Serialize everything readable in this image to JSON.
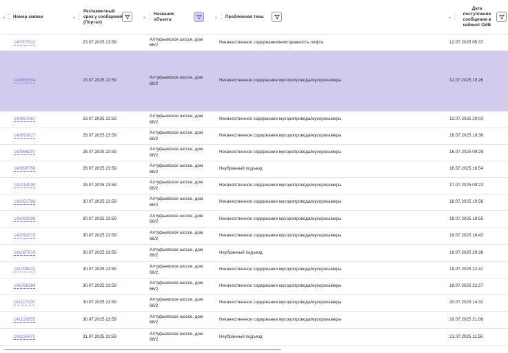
{
  "columns": [
    {
      "key": "number",
      "label": "Номер заявки"
    },
    {
      "key": "deadline",
      "label": "Регламентный срок у сообщения (Портал)"
    },
    {
      "key": "object",
      "label": "Название объекта"
    },
    {
      "key": "topic",
      "label": "Проблемная тема"
    },
    {
      "key": "received",
      "label": "Дата поступления сообщения в кабинет ОИВ"
    }
  ],
  "rows": [
    {
      "number": "140707912",
      "deadline": "23.07.2025 23:59",
      "object": "Алтуфьевское шоссе, дом 66/2",
      "topic": "Некачественное содержание/неисправность лифта",
      "received": "12.07.2025 05:37"
    },
    {
      "number": "140863564",
      "deadline": "23.07.2025 23:59",
      "object": "Алтуфьевское шоссе, дом 66/2",
      "topic": "Некачественное содержание мусоропровода/мусорокамеры",
      "received": "12.07.2025 19:26",
      "selected": true
    },
    {
      "number": "140867867",
      "deadline": "23.07.2025 23:59",
      "object": "Алтуфьевское шоссе, дом 66/2",
      "topic": "Некачественное содержание мусоропровода/мусорокамеры",
      "received": "12.07.2025 20:03"
    },
    {
      "number": "140893817",
      "deadline": "28.07.2025 23:59",
      "object": "Алтуфьевское шоссе, дом 66/2",
      "topic": "Некачественное содержание мусоропровода/мусорокамеры",
      "received": "16.07.2025 18:36"
    },
    {
      "number": "140968297",
      "deadline": "28.07.2025 23:59",
      "object": "Алтуфьевское шоссе, дом 66/2",
      "topic": "Некачественное содержание мусоропровода/мусорокамеры",
      "received": "16.07.2025 09:29"
    },
    {
      "number": "140990756",
      "deadline": "28.07.2025 23:59",
      "object": "Алтуфьевское шоссе, дом 66/2",
      "topic": "Неубранный подъезд",
      "received": "16.07.2025 16:54"
    },
    {
      "number": "141014530",
      "deadline": "29.07.2025 23:59",
      "object": "Алтуфьевское шоссе, дом 66/2",
      "topic": "Некачественное содержание мусоропровода/мусорокамеры",
      "received": "17.07.2025 09:23"
    },
    {
      "number": "141052788",
      "deadline": "30.07.2025 23:59",
      "object": "Алтуфьевское шоссе, дом 66/2",
      "topic": "Некачественное содержание мусоропровода/мусорокамеры",
      "received": "18.07.2025 10:58"
    },
    {
      "number": "141069396",
      "deadline": "30.07.2025 23:59",
      "object": "Алтуфьевское шоссе, дом 66/2",
      "topic": "Некачественное содержание мусоропровода/мусорокамеры",
      "received": "18.07.2025 19:55"
    },
    {
      "number": "141092015",
      "deadline": "30.07.2025 23:59",
      "object": "Алтуфьевское шоссе, дом 66/2",
      "topic": "Некачественное содержание мусоропровода/мусорокамеры",
      "received": "19.07.2025 16:43"
    },
    {
      "number": "141097519",
      "deadline": "30.07.2025 23:59",
      "object": "Алтуфьевское шоссе, дом 66/2",
      "topic": "Неубранный подъезд",
      "received": "19.07.2025 20:36"
    },
    {
      "number": "141098032",
      "deadline": "30.07.2025 23:59",
      "object": "Алтуфьевское шоссе, дом 66/2",
      "topic": "Некачественное содержание мусоропровода/мусорокамеры",
      "received": "19.07.2025 22:41"
    },
    {
      "number": "141098384",
      "deadline": "30.07.2025 23:59",
      "object": "Алтуфьевское шоссе, дом 66/2",
      "topic": "Некачественное содержание мусоропровода/мусорокамеры",
      "received": "19.07.2025 22:37"
    },
    {
      "number": "141117120",
      "deadline": "30.07.2025 23:59",
      "object": "Алтуфьевское шоссе, дом 66/2",
      "topic": "Некачественное содержание мусоропровода/мусорокамеры",
      "received": "20.07.2025 14:32"
    },
    {
      "number": "141129555",
      "deadline": "30.07.2025 23:59",
      "object": "Алтуфьевское шоссе, дом 66/2",
      "topic": "Некачественное содержание мусоропровода/мусорокамеры",
      "received": "20.07.2025 21:06"
    },
    {
      "number": "141130470",
      "deadline": "31.07.2025 23:59",
      "object": "Алтуфьевское шоссе, дом 66/2",
      "topic": "Неубранный подъезд",
      "received": "21.07.2025 11:56"
    }
  ],
  "colors": {
    "link": "#7a6fd0",
    "selected_row": "#d3cbed",
    "active_filter": "#d8d1f1"
  },
  "icons": {
    "sort": "sort-arrows-icon",
    "filter": "funnel-icon"
  }
}
